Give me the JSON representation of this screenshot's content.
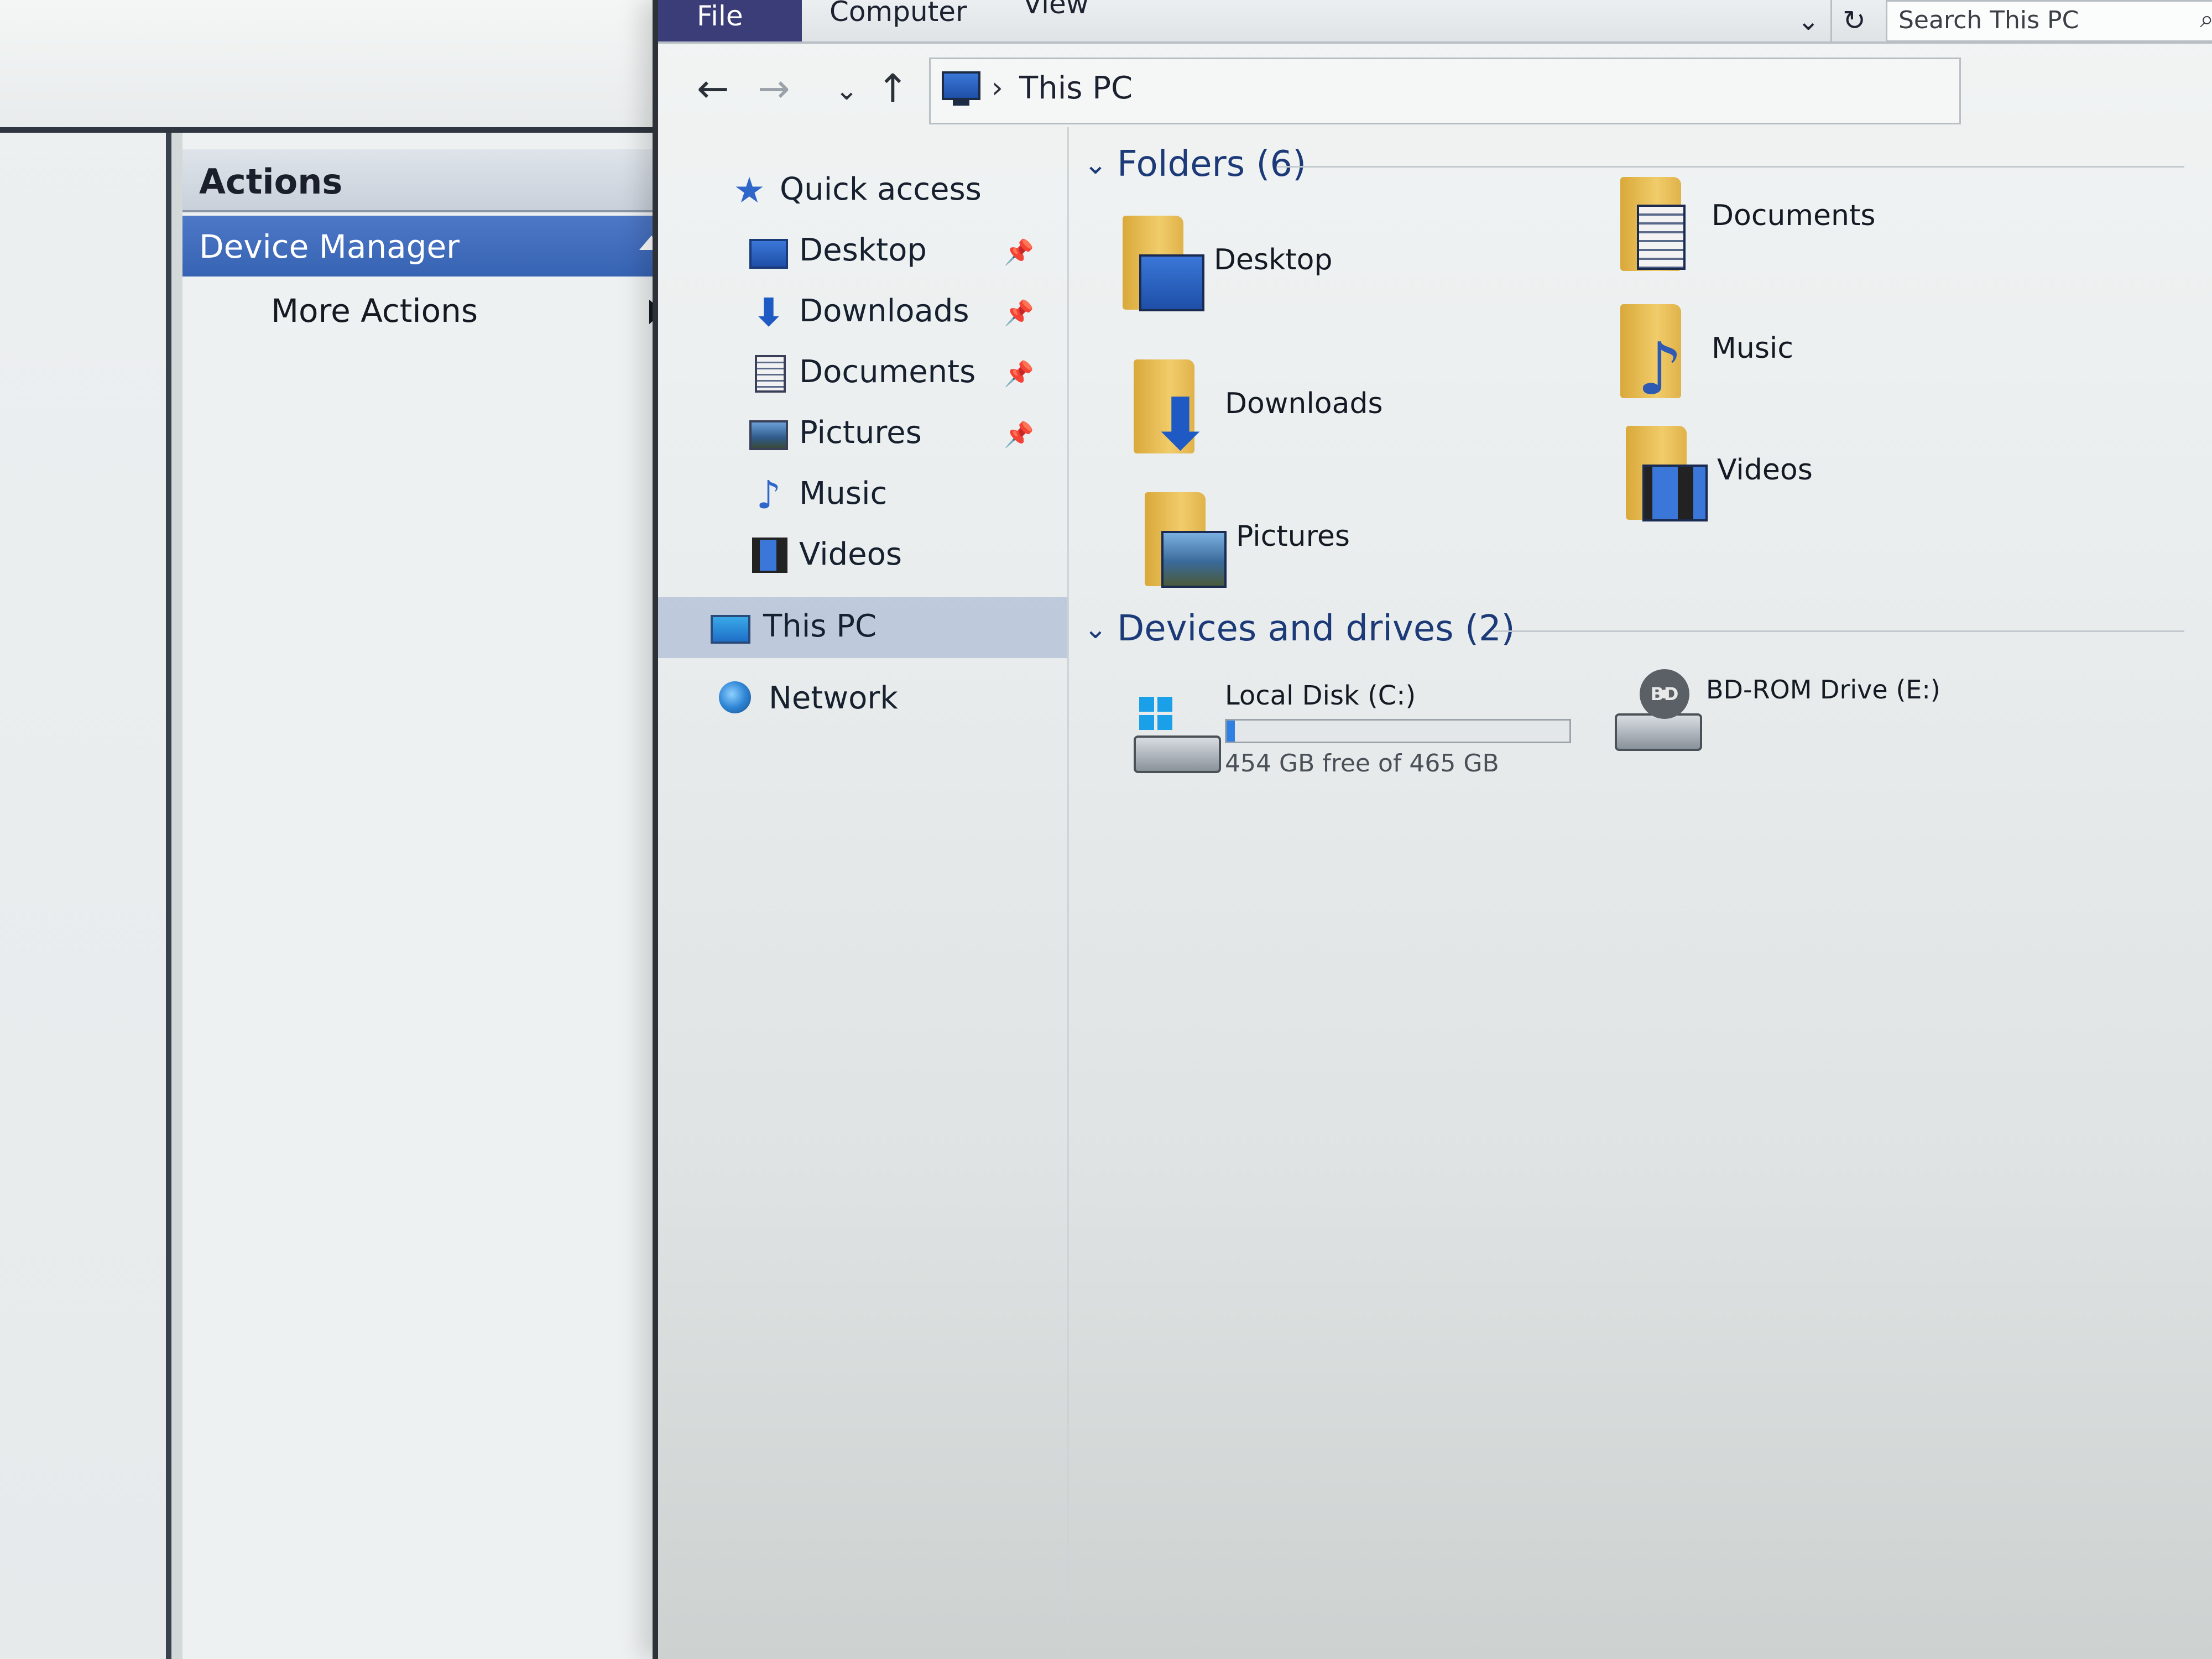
{
  "mmc": {
    "actions_title": "Actions",
    "device_manager_label": "Device Manager",
    "more_actions_label": "More Actions"
  },
  "explorer": {
    "tabs": [
      "File",
      "Computer",
      "View"
    ],
    "search": {
      "placeholder": "Search This PC"
    },
    "address": {
      "path": "This PC"
    },
    "nav": {
      "quick_access": "Quick access",
      "items": [
        {
          "label": "Desktop",
          "pinned": true,
          "icon": "desktop-icon"
        },
        {
          "label": "Downloads",
          "pinned": true,
          "icon": "downloads-icon"
        },
        {
          "label": "Documents",
          "pinned": true,
          "icon": "documents-icon"
        },
        {
          "label": "Pictures",
          "pinned": true,
          "icon": "pictures-icon"
        },
        {
          "label": "Music",
          "pinned": false,
          "icon": "music-icon"
        },
        {
          "label": "Videos",
          "pinned": false,
          "icon": "videos-icon"
        }
      ],
      "this_pc": "This PC",
      "network": "Network"
    },
    "folders": {
      "header": "Folders (6)",
      "items": [
        "Desktop",
        "Documents",
        "Downloads",
        "Music",
        "Pictures",
        "Videos"
      ]
    },
    "devices": {
      "header": "Devices and drives (2)",
      "local_disk": {
        "name": "Local Disk (C:)",
        "free_text": "454 GB free of 465 GB",
        "used_fraction": 0.024
      },
      "bd_rom": {
        "name": "BD-ROM Drive (E:)",
        "disc_label": "BD"
      }
    }
  }
}
